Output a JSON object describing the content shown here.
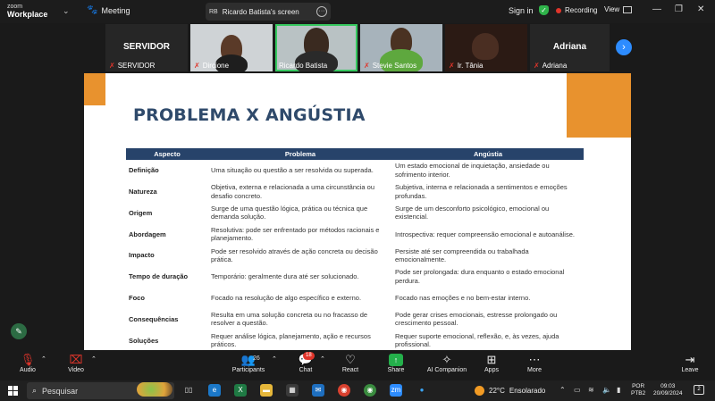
{
  "titlebar": {
    "logo_line1": "zoom",
    "logo_line2": "Workplace",
    "meeting_label": "Meeting",
    "screen_initials": "RB",
    "screen_label": "Ricardo Batista's screen",
    "sign_in": "Sign in",
    "recording": "Recording",
    "view": "View"
  },
  "participants": [
    {
      "name": "SERVIDOR",
      "tile_text": "SERVIDOR",
      "muted": true
    },
    {
      "name": "Dircione",
      "muted": true
    },
    {
      "name": "Ricardo Batista",
      "muted": false,
      "active": true
    },
    {
      "name": "Stevie Santos",
      "muted": true
    },
    {
      "name": "Ir. Tânia",
      "muted": true
    },
    {
      "name": "Adriana",
      "tile_text": "Adriana",
      "muted": true
    }
  ],
  "slide": {
    "title": "PROBLEMA X ANGÚSTIA",
    "headers": [
      "Aspecto",
      "Problema",
      "Angústia"
    ],
    "rows": [
      [
        "Definição",
        "Uma situação ou questão a ser resolvida ou superada.",
        "Um estado emocional de inquietação, ansiedade ou sofrimento interior."
      ],
      [
        "Natureza",
        "Objetiva, externa e relacionada a uma circunstância ou desafio concreto.",
        "Subjetiva, interna e relacionada a sentimentos e emoções profundas."
      ],
      [
        "Origem",
        "Surge de uma questão lógica, prática ou técnica que demanda solução.",
        "Surge de um desconforto psicológico, emocional ou existencial."
      ],
      [
        "Abordagem",
        "Resolutiva: pode ser enfrentado por métodos racionais e planejamento.",
        "Introspectiva: requer compreensão emocional e autoanálise."
      ],
      [
        "Impacto",
        "Pode ser resolvido através de ação concreta ou decisão prática.",
        "Persiste até ser compreendida ou trabalhada emocionalmente."
      ],
      [
        "Tempo de duração",
        "Temporário: geralmente dura até ser solucionado.",
        "Pode ser prolongada: dura enquanto o estado emocional perdura."
      ],
      [
        "Foco",
        "Focado na resolução de algo específico e externo.",
        "Focado nas emoções e no bem-estar interno."
      ],
      [
        "Consequências",
        "Resulta em uma solução concreta ou no fracasso de resolver a questão.",
        "Pode gerar crises emocionais, estresse prolongado ou crescimento pessoal."
      ],
      [
        "Soluções",
        "Requer análise lógica, planejamento, ação e recursos práticos.",
        "Requer suporte emocional, reflexão, e, às vezes, ajuda profissional."
      ]
    ]
  },
  "toolbar": {
    "audio": "Audio",
    "video": "Video",
    "participants": "Participants",
    "participants_count": "26",
    "chat": "Chat",
    "chat_badge": "18",
    "react": "React",
    "share": "Share",
    "ai_companion": "AI Companion",
    "apps": "Apps",
    "more": "More",
    "leave": "Leave"
  },
  "taskbar": {
    "search_placeholder": "Pesquisar",
    "weather_temp": "22°C",
    "weather_desc": "Ensolarado",
    "lang_line1": "POR",
    "lang_line2": "PTB2",
    "time": "09:03",
    "date": "20/09/2024",
    "notifications": "2"
  },
  "colors": {
    "slide_accent": "#e8922e",
    "table_header": "#27436a",
    "title_text": "#2f4a6b",
    "zoom_blue": "#2d8cff",
    "share_green": "#24b04b",
    "recording_red": "#e0352b"
  }
}
